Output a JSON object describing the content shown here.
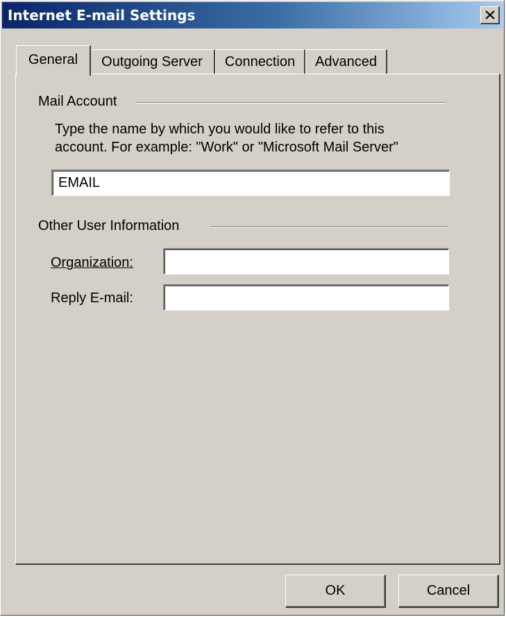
{
  "window": {
    "title": "Internet E-mail Settings",
    "close_icon": "close-icon"
  },
  "tabs": [
    {
      "label": "General",
      "active": true
    },
    {
      "label": "Outgoing Server",
      "active": false
    },
    {
      "label": "Connection",
      "active": false
    },
    {
      "label": "Advanced",
      "active": false
    }
  ],
  "mail_account": {
    "group_label": "Mail Account",
    "description_line1": "Type the name by which you would like to refer to this",
    "description_line2": "account.  For example: \"Work\" or \"Microsoft Mail Server\"",
    "account_name_value": "EMAIL"
  },
  "other_user_info": {
    "group_label": "Other User Information",
    "organization_label": "Organization:",
    "organization_value": "",
    "reply_email_label": "Reply E-mail:",
    "reply_email_value": ""
  },
  "buttons": {
    "ok_label": "OK",
    "cancel_label": "Cancel"
  },
  "colors": {
    "dialog_face": "#d4d0c8",
    "title_gradient_start": "#0a246a",
    "title_gradient_end": "#a6caf0"
  }
}
